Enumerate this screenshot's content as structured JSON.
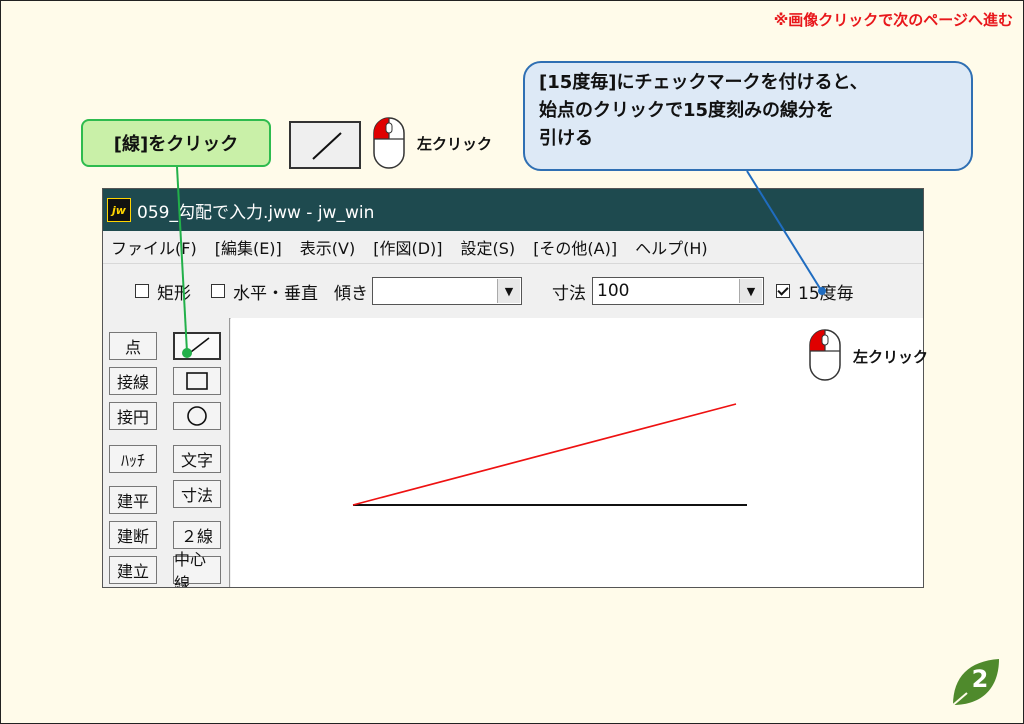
{
  "note": "※画像クリックで次のページへ進む",
  "callout_line": "[線]をクリック",
  "callout_info": {
    "line1": "[15度毎]にチェックマークを付けると、",
    "line2": "始点のクリックで15度刻みの線分を",
    "line3": "引ける"
  },
  "mouse_label_1": "左クリック",
  "mouse_label_2": "左クリック",
  "window": {
    "title": "059_勾配で入力.jww - jw_win",
    "logo": "jw",
    "menu": [
      "ファイル(F)",
      "[編集(E)]",
      "表示(V)",
      "[作図(D)]",
      "設定(S)",
      "[その他(A)]",
      "ヘルプ(H)"
    ],
    "toolbar": {
      "rect_label": "矩形",
      "hv_label": "水平・垂直",
      "tilt_label": "傾き",
      "tilt_value": "",
      "size_label": "寸法",
      "size_value": "100",
      "deg15_label": "15度毎"
    },
    "tools": {
      "point": "点",
      "tangent_line": "接線",
      "tangent_circle": "接円",
      "hatch": "ﾊｯﾁ",
      "text": "文字",
      "dimension": "寸法",
      "kenpei": "建平",
      "kendan": "建断",
      "double_line": "２線",
      "kenritsu": "建立",
      "center_line": "中心線"
    }
  },
  "page_number": "2",
  "colors": {
    "accent_red": "#e8171b",
    "title_bar": "#1e4a4f",
    "green_callout": "#c9f0a8",
    "blue_callout": "#dde9f6",
    "badge": "#4f8a2c"
  }
}
